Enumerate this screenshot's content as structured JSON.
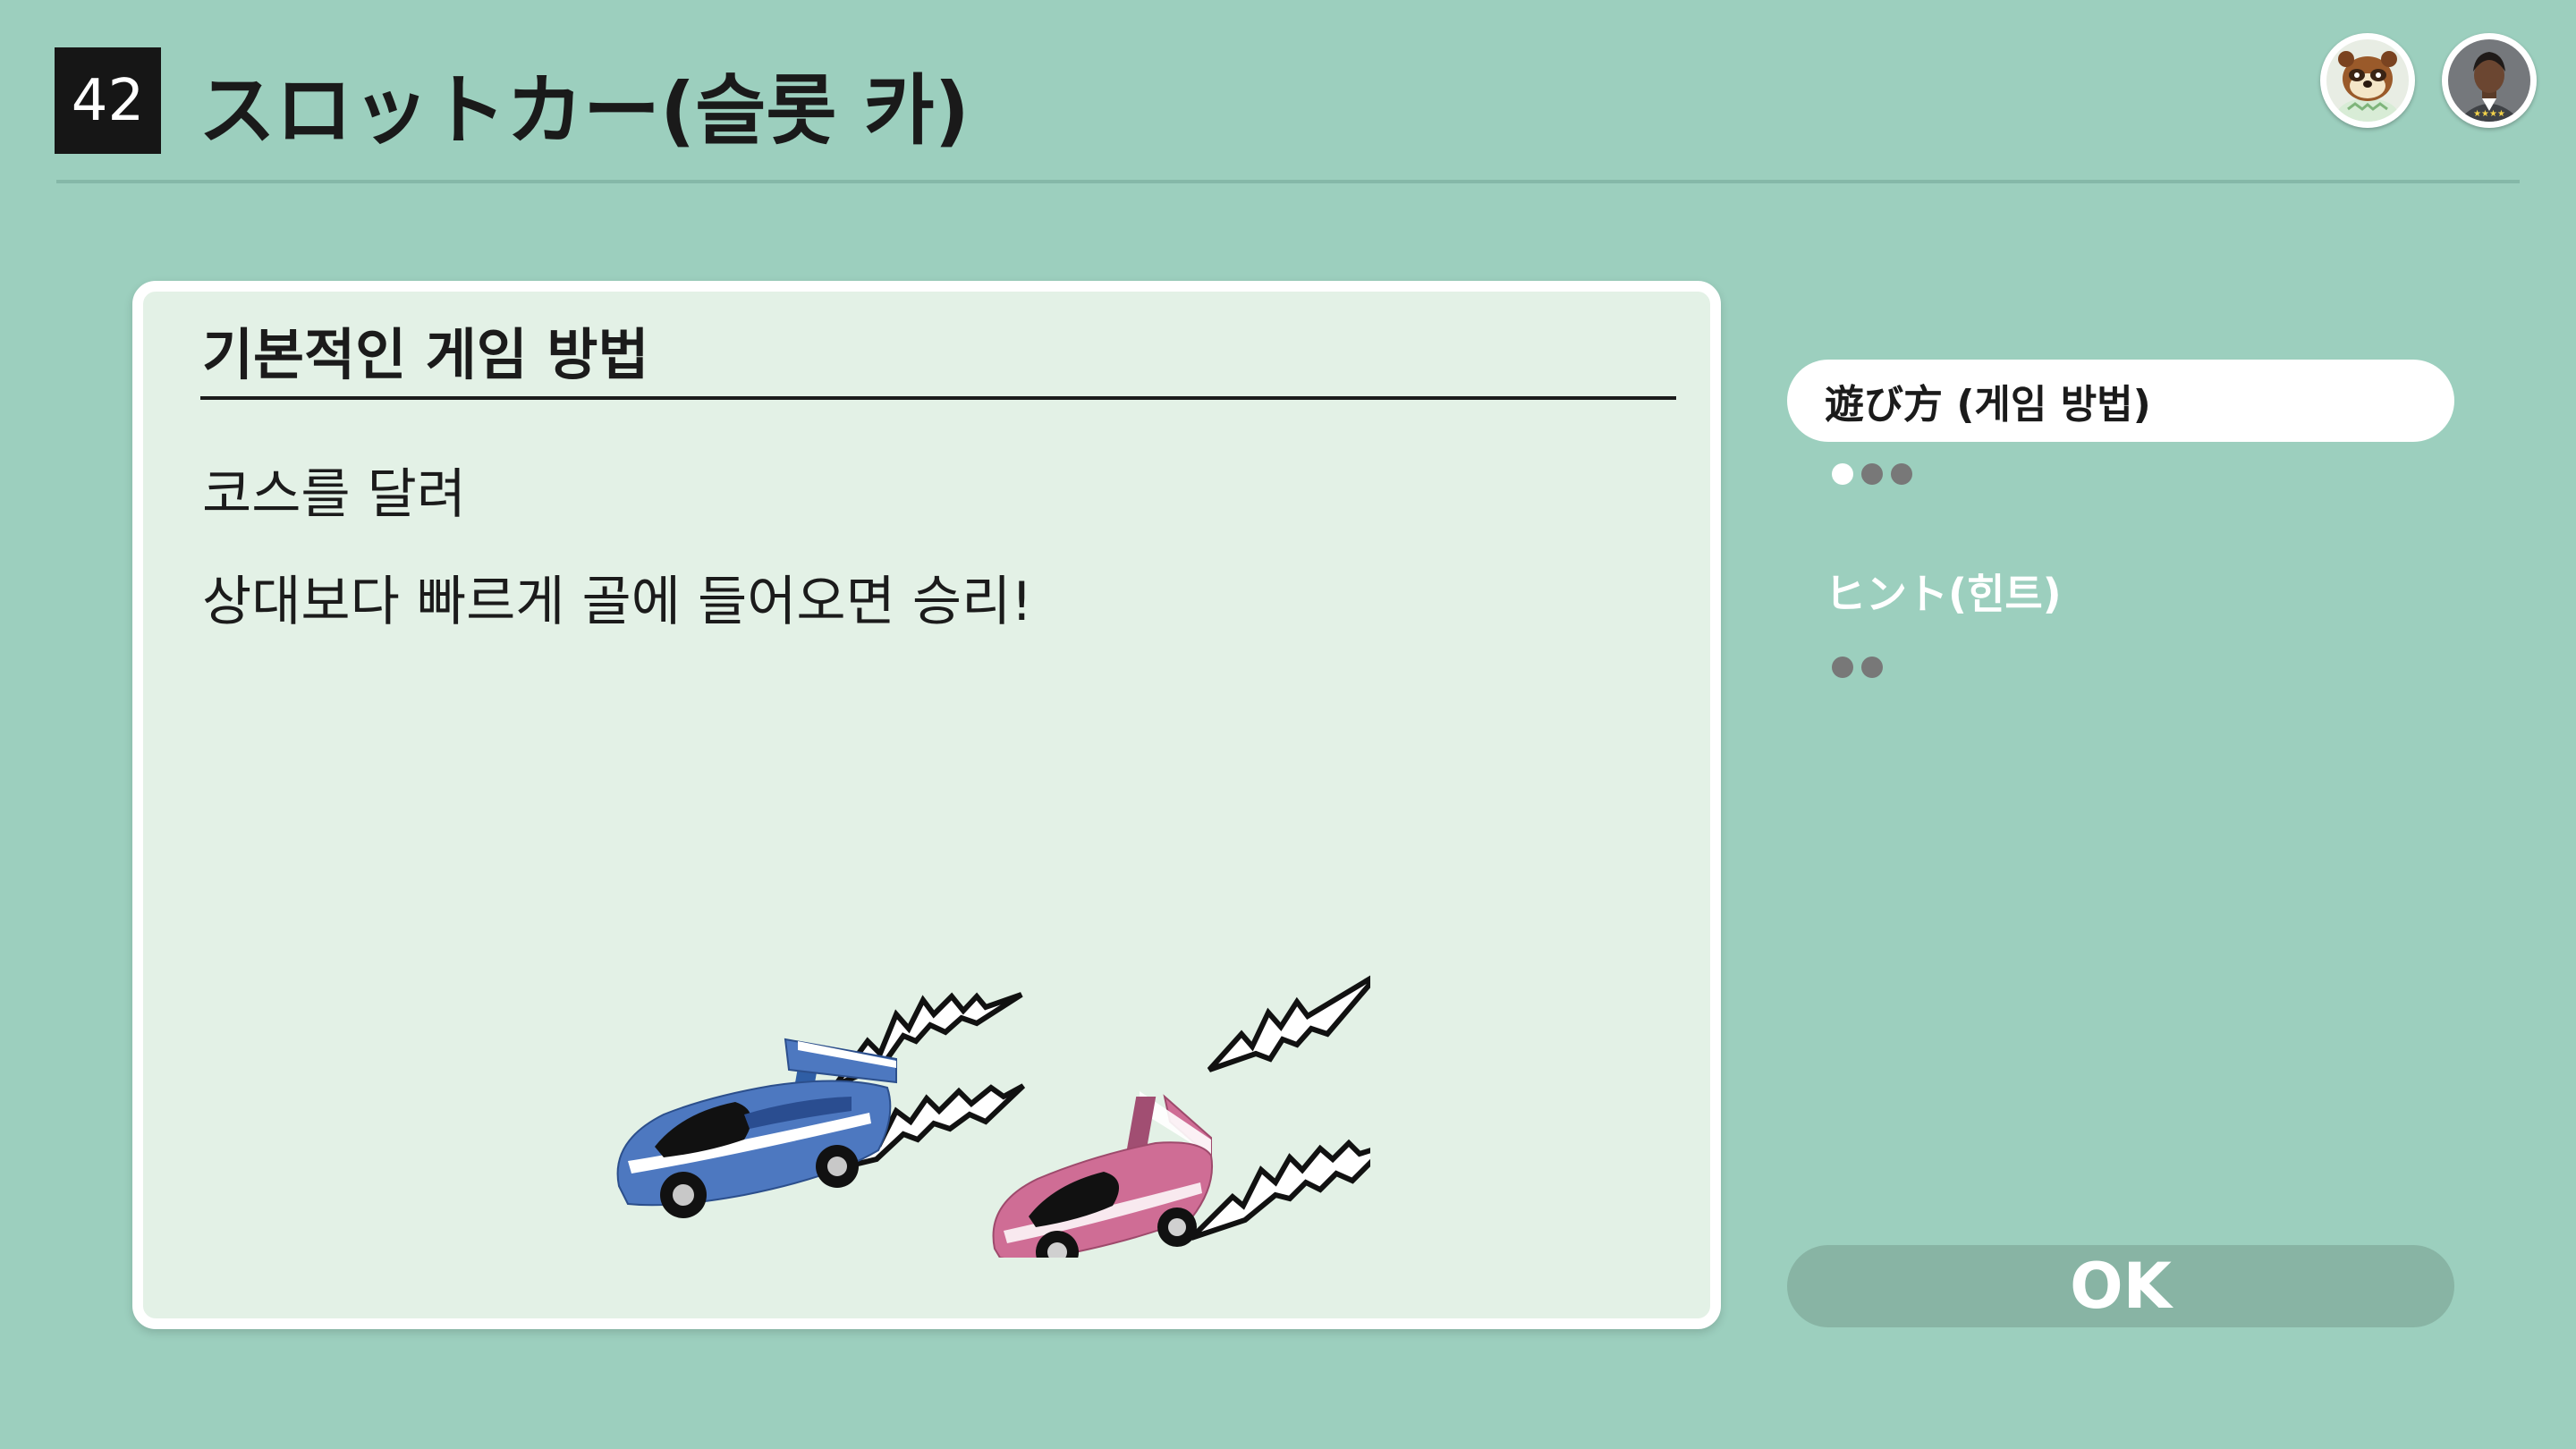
{
  "header": {
    "number": "42",
    "title": "スロットカー(슬롯 카)"
  },
  "card": {
    "heading": "기본적인 게임 방법",
    "lines": [
      "코스를 달려",
      "상대보다 빠르게 골에 들어오면 승리!"
    ]
  },
  "sidebar": {
    "tabs": [
      {
        "label": "遊び方 (게임 방법)",
        "pages": 3,
        "current_page": 1
      },
      {
        "label": "ヒント(힌트)",
        "pages": 2,
        "current_page": 0
      }
    ],
    "ok_label": "OK"
  },
  "players": [
    {
      "icon": "raccoon-character-avatar-icon"
    },
    {
      "icon": "user-avatar-icon"
    }
  ],
  "colors": {
    "background": "#9ccfbe",
    "card": "#e3f1e6",
    "car_blue": "#4d78c0",
    "car_pink": "#cf6d95",
    "ok_button": "#88b4a4"
  }
}
